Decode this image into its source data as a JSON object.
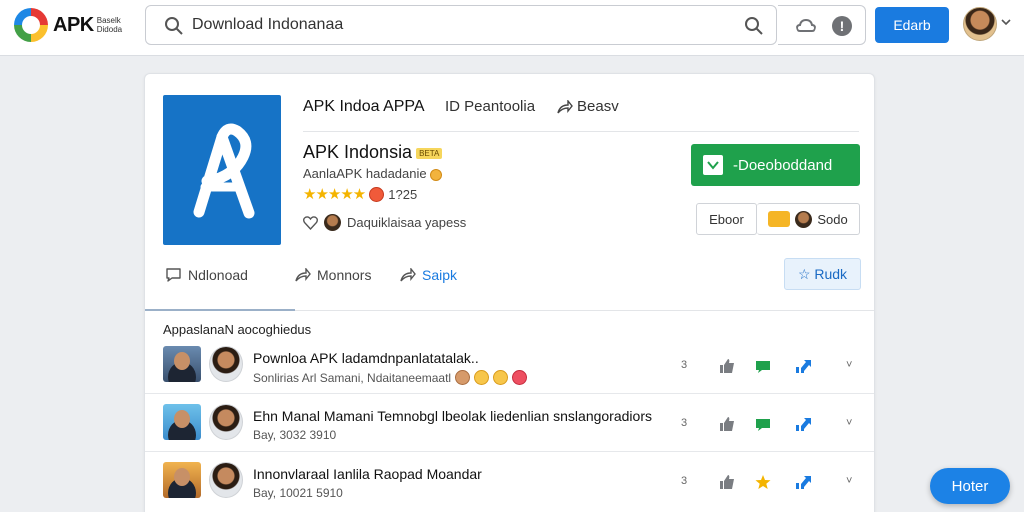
{
  "header": {
    "logo_text": "APK",
    "logo_sub": "Baselk Didoda",
    "search": {
      "value": "Download Indonanaa",
      "placeholder": "Download Indonanaa"
    },
    "alert_glyph": "!",
    "primary_button": "Edarb"
  },
  "app": {
    "tabs": [
      {
        "label": "APK Indoa APPA"
      },
      {
        "label": "ID Peantoolia"
      },
      {
        "label": "Beasv"
      }
    ],
    "name": "APK Indonsia",
    "name_badge": "BETA",
    "subtitle": "AanlaAPK hadadanie",
    "rating_text": "1?25",
    "stars": "★★★★★",
    "developer": "Daquiklaisaa yapess",
    "download_label": "-Doeoboddand",
    "small_buttons": [
      "Eboor",
      "Sodo"
    ]
  },
  "actions": {
    "items": [
      "Ndlonoad",
      "Monnors",
      "Saipk"
    ],
    "right_button": "☆ Rudk"
  },
  "list": {
    "section_title": "AppaslanaN aocoghiedus",
    "rows": [
      {
        "title": "Pownloa APK ladamdnpanlatatalak..",
        "meta": "Sonlirias Arl Samani, Ndaitaneemaatl"
      },
      {
        "title": "Ehn Manal Mamani  Temnobgl lbeolak  liedenlian  snslangoradiors",
        "meta": "Bay, 3032 3910"
      },
      {
        "title": "Innonvlaraal  Ianlila  Raopad Moandar",
        "meta": "Bay, 10021 5910"
      }
    ],
    "row_counter": "3",
    "row_chevron": "˅"
  },
  "fab_label": "Hoter",
  "colors": {
    "brand_blue": "#1a7be0",
    "download_green": "#1fa14c",
    "app_icon_blue": "#1673c6",
    "star_yellow": "#f4b400"
  },
  "icons": [
    "search-icon",
    "cloud-icon",
    "alert-icon",
    "chat-icon",
    "share-icon",
    "heart-icon",
    "like-icon",
    "bookmark-icon",
    "chevron-down-icon"
  ]
}
